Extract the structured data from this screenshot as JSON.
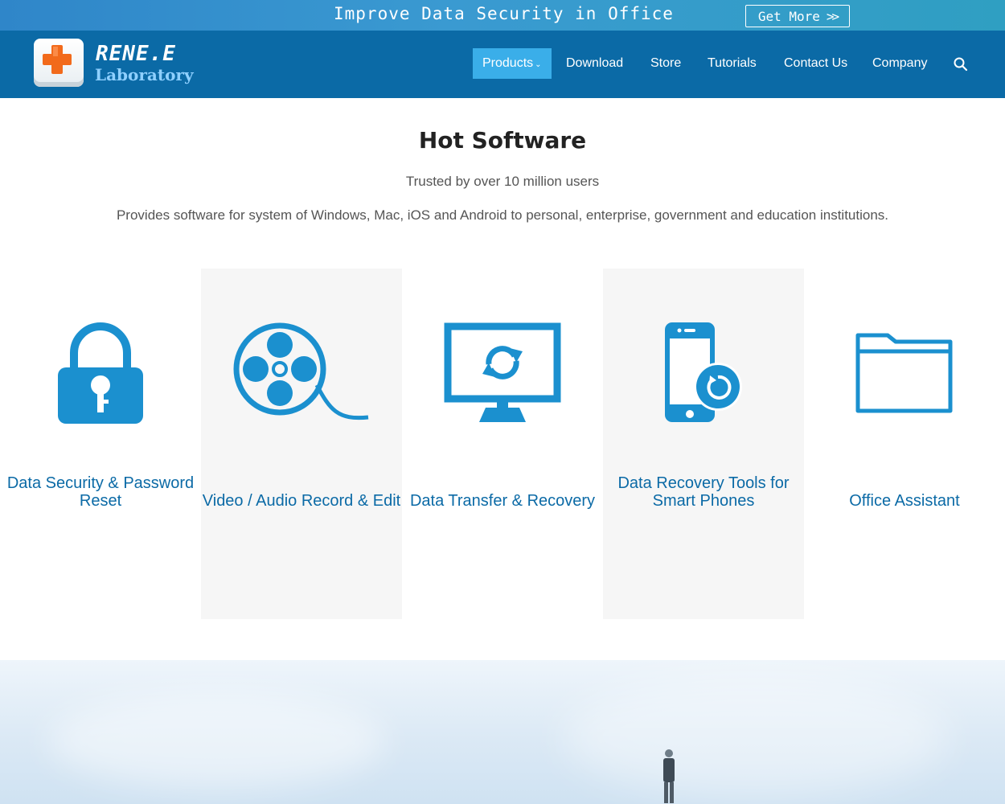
{
  "promo": {
    "text": "Improve Data Security in Office",
    "button_label": "Get More",
    "button_arrows": ">>"
  },
  "header": {
    "logo_name": "RENE.E",
    "logo_sub": "Laboratory",
    "nav": [
      {
        "label": "Products",
        "active": true
      },
      {
        "label": "Download"
      },
      {
        "label": "Store"
      },
      {
        "label": "Tutorials"
      },
      {
        "label": "Contact Us"
      },
      {
        "label": "Company"
      }
    ]
  },
  "hot": {
    "title": "Hot Software",
    "subtitle": "Trusted by over 10 million users",
    "description": "Provides software for system of Windows, Mac, iOS and Android to personal, enterprise, government and education institutions.",
    "categories": [
      {
        "label": "Data Security & Password Reset",
        "icon": "lock-icon"
      },
      {
        "label": "Video / Audio Record & Edit",
        "icon": "film-reel-icon"
      },
      {
        "label": "Data Transfer & Recovery",
        "icon": "monitor-sync-icon"
      },
      {
        "label": "Data Recovery Tools for Smart Phones",
        "icon": "phone-recovery-icon"
      },
      {
        "label": "Office Assistant",
        "icon": "folder-icon"
      }
    ]
  },
  "colors": {
    "header": "#0b6aa6",
    "accent": "#3aaee9",
    "icon": "#1b90cf",
    "label": "#0b6aa6"
  }
}
